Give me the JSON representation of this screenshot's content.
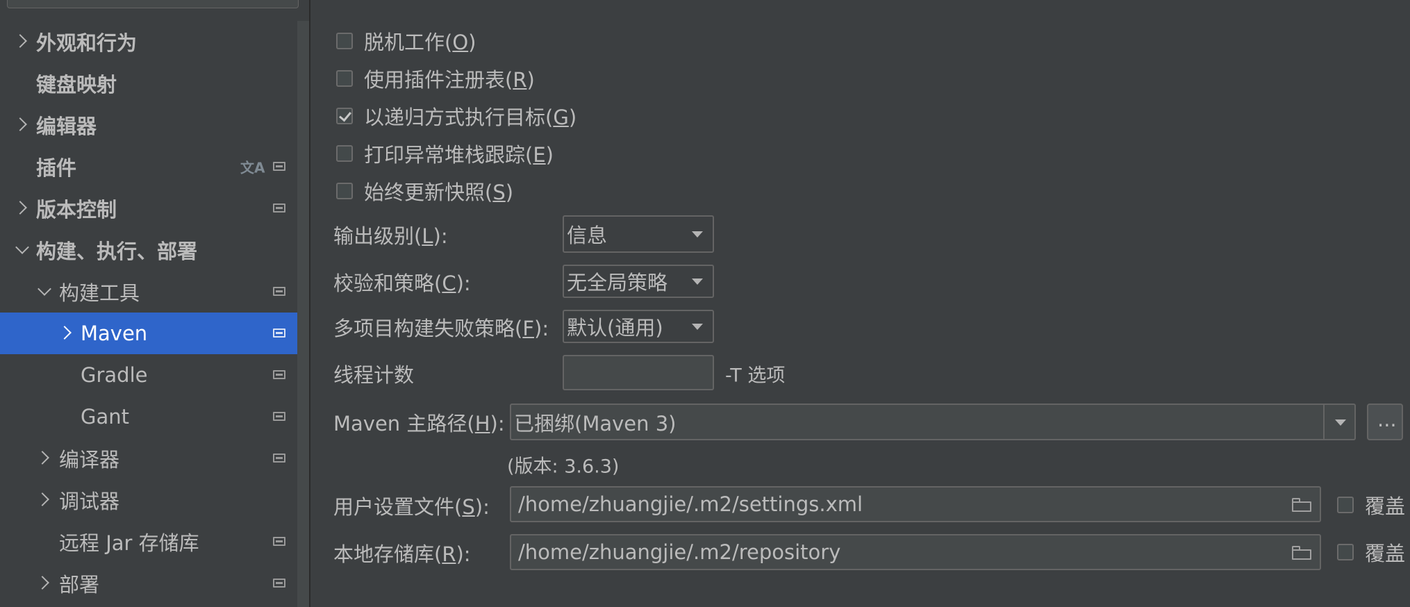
{
  "sidebar": {
    "items": [
      {
        "label": "外观和行为",
        "chevron": "right",
        "level": 0,
        "bold": true
      },
      {
        "label": "键盘映射",
        "chevron": "none",
        "level": 0,
        "bold": true
      },
      {
        "label": "编辑器",
        "chevron": "right",
        "level": 0,
        "bold": true
      },
      {
        "label": "插件",
        "chevron": "none",
        "level": 0,
        "bold": true,
        "icons": [
          "translate-icon",
          "project-icon"
        ]
      },
      {
        "label": "版本控制",
        "chevron": "right",
        "level": 0,
        "bold": true,
        "icons": [
          "project-icon"
        ]
      },
      {
        "label": "构建、执行、部署",
        "chevron": "down",
        "level": 0,
        "bold": true
      },
      {
        "label": "构建工具",
        "chevron": "down",
        "level": 1,
        "icons": [
          "project-icon"
        ]
      },
      {
        "label": "Maven",
        "chevron": "right",
        "level": 2,
        "selected": true,
        "icons": [
          "project-icon"
        ]
      },
      {
        "label": "Gradle",
        "chevron": "none",
        "level": 2,
        "icons": [
          "project-icon"
        ]
      },
      {
        "label": "Gant",
        "chevron": "none",
        "level": 2,
        "icons": [
          "project-icon"
        ]
      },
      {
        "label": "编译器",
        "chevron": "right",
        "level": 1,
        "icons": [
          "project-icon"
        ]
      },
      {
        "label": "调试器",
        "chevron": "right",
        "level": 1
      },
      {
        "label": "远程 Jar 存储库",
        "chevron": "none",
        "level": 1,
        "icons": [
          "project-icon"
        ]
      },
      {
        "label": "部署",
        "chevron": "right",
        "level": 1,
        "icons": [
          "project-icon"
        ]
      }
    ]
  },
  "main": {
    "checkboxes": [
      {
        "text": "脱机工作(",
        "mnemonic": "O",
        "after": ")",
        "checked": false
      },
      {
        "text": "使用插件注册表(",
        "mnemonic": "R",
        "after": ")",
        "checked": false
      },
      {
        "text": "以递归方式执行目标(",
        "mnemonic": "G",
        "after": ")",
        "checked": true
      },
      {
        "text": "打印异常堆栈跟踪(",
        "mnemonic": "E",
        "after": ")",
        "checked": false
      },
      {
        "text": "始终更新快照(",
        "mnemonic": "S",
        "after": ")",
        "checked": false
      }
    ],
    "output_level": {
      "label": "输出级别(",
      "mnemonic": "L",
      "after": "):",
      "value": "信息"
    },
    "checksum_policy": {
      "label": "校验和策略(",
      "mnemonic": "C",
      "after": "):",
      "value": "无全局策略"
    },
    "fail_policy": {
      "label": "多项目构建失败策略(",
      "mnemonic": "F",
      "after": "):",
      "value": "默认(通用)"
    },
    "thread_count": {
      "label": "线程计数",
      "value": "",
      "suffix": "-T 选项"
    },
    "maven_home": {
      "label": "Maven 主路径(",
      "mnemonic": "H",
      "after": "):",
      "value": "已捆绑(Maven 3)",
      "browse": "...",
      "version": "(版本: 3.6.3)"
    },
    "user_settings": {
      "label": "用户设置文件(",
      "mnemonic": "S",
      "after": "):",
      "value": "/home/zhuangjie/.m2/settings.xml",
      "override": "覆盖"
    },
    "local_repo": {
      "label": "本地存储库(",
      "mnemonic": "R",
      "after": "):",
      "value": "/home/zhuangjie/.m2/repository",
      "override": "覆盖"
    }
  },
  "colors": {
    "background": "#3c3f41",
    "selection": "#2f65ca",
    "text": "#bbbbbb",
    "border": "#646464"
  }
}
